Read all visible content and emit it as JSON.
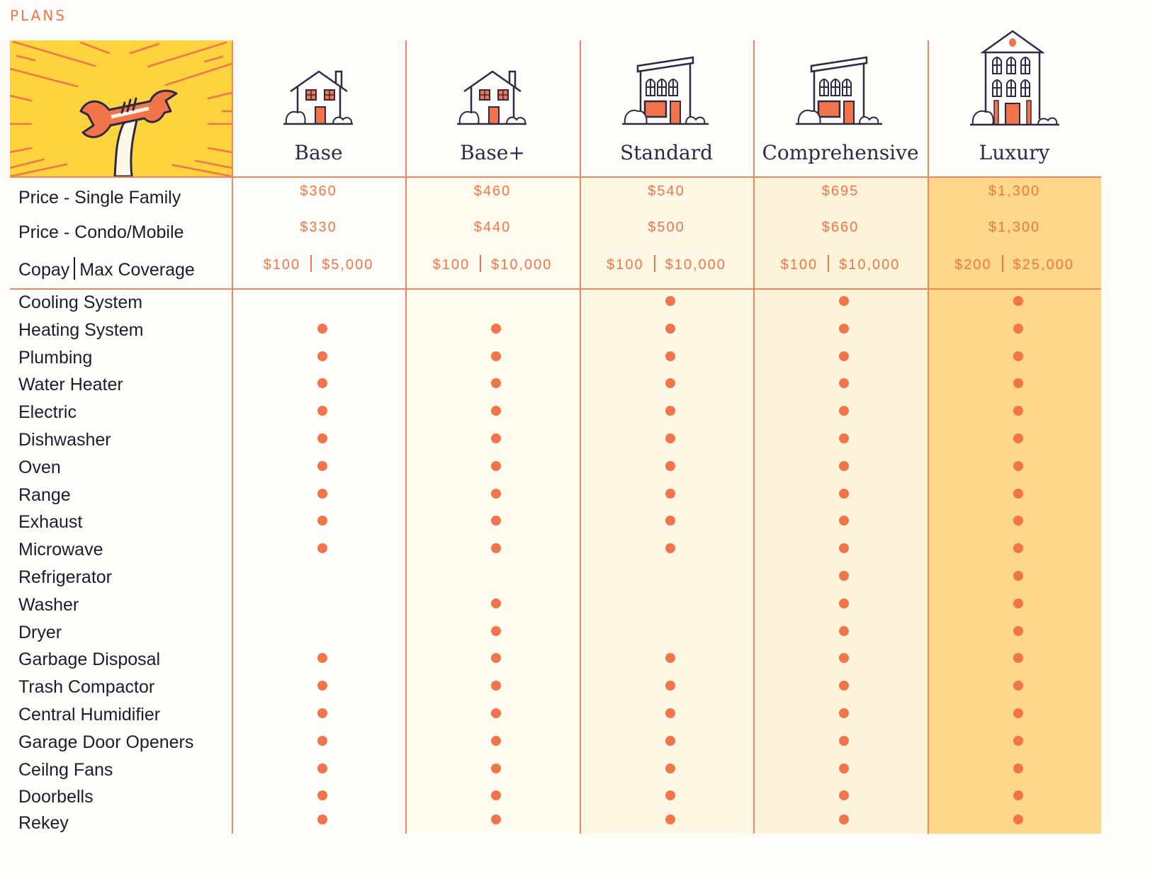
{
  "section_label": "PLANS",
  "colors": {
    "accent": "#f2744a",
    "hero_bg": "#ffd33d",
    "column_bg": [
      "#fffdf9",
      "#fffbef",
      "#fef7e4",
      "#fcf3d8",
      "#fdd888"
    ]
  },
  "plans": [
    {
      "name": "Base",
      "icon": "house-icon",
      "price_single_family": "$360",
      "price_condo_mobile": "$330",
      "copay": "$100",
      "max_coverage": "$5,000"
    },
    {
      "name": "Base+",
      "icon": "house-icon",
      "price_single_family": "$460",
      "price_condo_mobile": "$440",
      "copay": "$100",
      "max_coverage": "$10,000"
    },
    {
      "name": "Standard",
      "icon": "townhouse-icon",
      "price_single_family": "$540",
      "price_condo_mobile": "$500",
      "copay": "$100",
      "max_coverage": "$10,000"
    },
    {
      "name": "Comprehensive",
      "icon": "townhouse-icon",
      "price_single_family": "$695",
      "price_condo_mobile": "$660",
      "copay": "$100",
      "max_coverage": "$10,000"
    },
    {
      "name": "Luxury",
      "icon": "mansion-icon",
      "price_single_family": "$1,300",
      "price_condo_mobile": "$1,300",
      "copay": "$200",
      "max_coverage": "$25,000"
    }
  ],
  "price_rows": {
    "single_family": "Price - Single Family",
    "condo_mobile": "Price - Condo/Mobile",
    "copay_label_a": "Copay",
    "copay_label_b": "Max Coverage"
  },
  "features": [
    {
      "name": "Cooling System",
      "included": [
        false,
        false,
        true,
        true,
        true
      ]
    },
    {
      "name": "Heating System",
      "included": [
        true,
        true,
        true,
        true,
        true
      ]
    },
    {
      "name": "Plumbing",
      "included": [
        true,
        true,
        true,
        true,
        true
      ]
    },
    {
      "name": "Water Heater",
      "included": [
        true,
        true,
        true,
        true,
        true
      ]
    },
    {
      "name": "Electric",
      "included": [
        true,
        true,
        true,
        true,
        true
      ]
    },
    {
      "name": "Dishwasher",
      "included": [
        true,
        true,
        true,
        true,
        true
      ]
    },
    {
      "name": "Oven",
      "included": [
        true,
        true,
        true,
        true,
        true
      ]
    },
    {
      "name": "Range",
      "included": [
        true,
        true,
        true,
        true,
        true
      ]
    },
    {
      "name": "Exhaust",
      "included": [
        true,
        true,
        true,
        true,
        true
      ]
    },
    {
      "name": "Microwave",
      "included": [
        true,
        true,
        true,
        true,
        true
      ]
    },
    {
      "name": "Refrigerator",
      "included": [
        false,
        false,
        false,
        true,
        true
      ]
    },
    {
      "name": "Washer",
      "included": [
        false,
        true,
        false,
        true,
        true
      ]
    },
    {
      "name": "Dryer",
      "included": [
        false,
        true,
        false,
        true,
        true
      ]
    },
    {
      "name": "Garbage Disposal",
      "included": [
        true,
        true,
        true,
        true,
        true
      ]
    },
    {
      "name": "Trash Compactor",
      "included": [
        true,
        true,
        true,
        true,
        true
      ]
    },
    {
      "name": "Central Humidifier",
      "included": [
        true,
        true,
        true,
        true,
        true
      ]
    },
    {
      "name": "Garage Door Openers",
      "included": [
        true,
        true,
        true,
        true,
        true
      ]
    },
    {
      "name": "Ceilng Fans",
      "included": [
        true,
        true,
        true,
        true,
        true
      ]
    },
    {
      "name": "Doorbells",
      "included": [
        true,
        true,
        true,
        true,
        true
      ]
    },
    {
      "name": "Rekey",
      "included": [
        true,
        true,
        true,
        true,
        true
      ]
    }
  ]
}
